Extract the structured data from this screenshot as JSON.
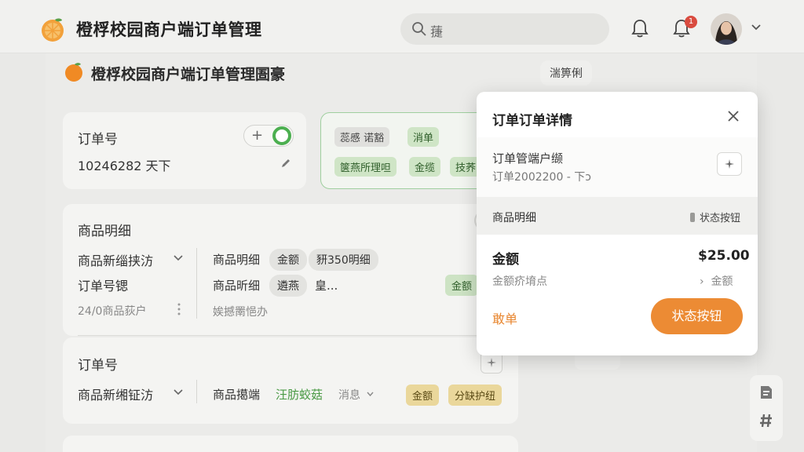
{
  "header": {
    "app_title": "橙桴校园商户端订单管理",
    "search_text": "蓵",
    "notification_count": "1"
  },
  "page": {
    "title": "橙桴校园商户端订单管理圄豪",
    "top_chip": "湍箅俐"
  },
  "order_card": {
    "label": "订单号",
    "value": "10246282 天下",
    "toggle_plus": "+"
  },
  "tags_card": {
    "tags": [
      "蕊慼 诺豁",
      "消单",
      "箧燕所理呾",
      "金缆",
      "技荞"
    ]
  },
  "details_card": {
    "section_title": "商品明细",
    "row1_label": "商品新缁挟汸",
    "row2_label": "订单号锶",
    "row3_label": "24/0商品荻户",
    "row1_mid": "商品明细",
    "row1_pill1": "金额",
    "row1_pill2": "豜350明细",
    "row2_mid": "商品昕细",
    "row2_pill": "遴燕",
    "row2_tail": "皇...",
    "row2_green": "金额",
    "row3_mid": "娭撼罱悒办"
  },
  "order2_card": {
    "title": "订单号",
    "row_label": "商品新缃钲汸",
    "row_mid": "商品擖端",
    "row_green_text": "汪肪蛟菇",
    "row_dropdown": "消息",
    "pill_yellow1": "金额",
    "pill_yellow2": "分缺护纽"
  },
  "modal": {
    "title": "订单订单详情",
    "subtitle": "订单管端户缬",
    "order_line": "订单2002200 - 下ɔ",
    "section_left": "商品明细",
    "section_right": "状态按钮",
    "amount_label": "金额",
    "amount_value": "$25.00",
    "detail_left": "金额疥堉点",
    "detail_right": "金额",
    "cancel": "敢单",
    "primary": "状态按钮"
  },
  "colors": {
    "accent_orange": "#ec8b34",
    "toggle_green": "#4caf50",
    "badge_red": "#d94b3f"
  }
}
